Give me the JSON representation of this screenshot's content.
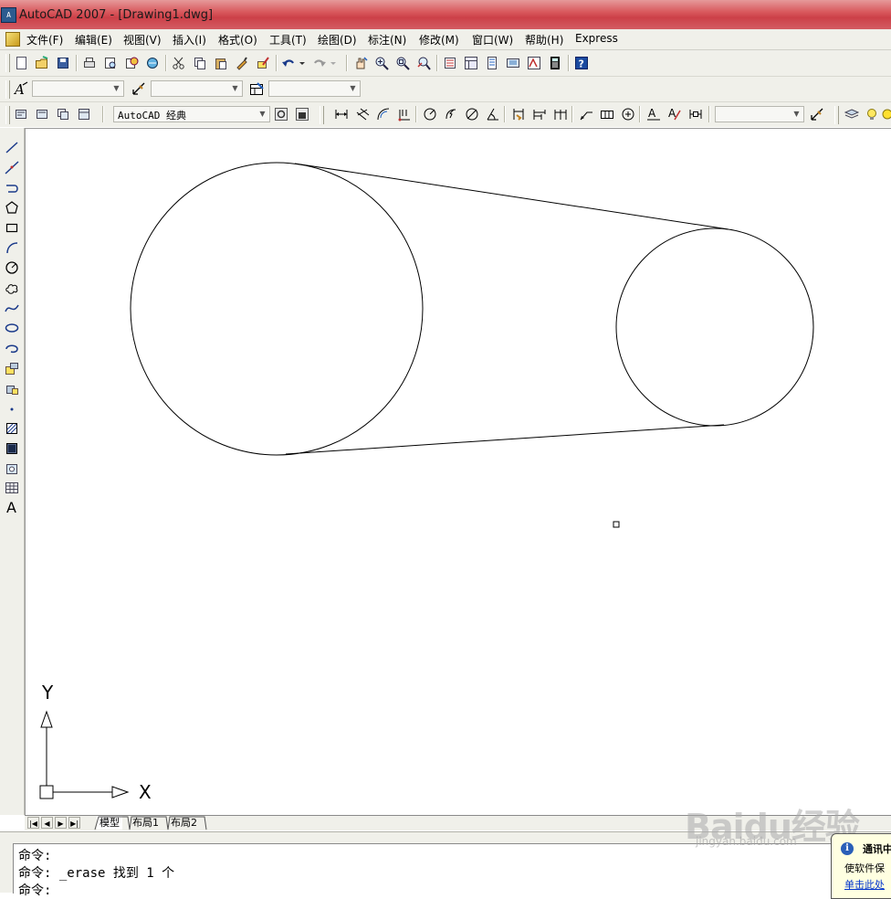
{
  "window": {
    "title": "AutoCAD 2007 - [Drawing1.dwg]",
    "app_icon_text": "A"
  },
  "menu": [
    "文件(F)",
    "编辑(E)",
    "视图(V)",
    "插入(I)",
    "格式(O)",
    "工具(T)",
    "绘图(D)",
    "标注(N)",
    "修改(M)",
    "窗口(W)",
    "帮助(H)",
    "Express"
  ],
  "toolbar_standard": {
    "icons": [
      "new-icon",
      "open-icon",
      "save-icon",
      "plot-icon",
      "plot-preview-icon",
      "publish-icon",
      "3d-dwf-icon",
      "cut-icon",
      "copy-icon",
      "paste-icon",
      "match-properties-icon",
      "block-editor-icon",
      "undo-icon",
      "redo-icon",
      "pan-icon",
      "zoom-realtime-icon",
      "zoom-window-icon",
      "zoom-previous-icon",
      "properties-icon",
      "design-center-icon",
      "tool-palettes-icon",
      "sheet-set-icon",
      "markup-icon",
      "calculator-icon",
      "help-icon"
    ]
  },
  "toolbar_styles": {
    "text_style_value": "",
    "dim_style_value": "",
    "table_style_value": ""
  },
  "toolbar_workspace": {
    "workspace_value": "AutoCAD 经典",
    "layer_value": ""
  },
  "draw_toolbar": {
    "icons": [
      "line-icon",
      "construction-line-icon",
      "polyline-icon",
      "polygon-icon",
      "rectangle-icon",
      "arc-icon",
      "circle-icon",
      "revision-cloud-icon",
      "spline-icon",
      "ellipse-icon",
      "ellipse-arc-icon",
      "insert-block-icon",
      "make-block-icon",
      "point-icon",
      "hatch-icon",
      "gradient-icon",
      "region-icon",
      "table-icon",
      "multiline-text-icon"
    ],
    "text_button_label": "A"
  },
  "ucs": {
    "x_label": "X",
    "y_label": "Y"
  },
  "layout_tabs": [
    "模型",
    "布局1",
    "布局2"
  ],
  "active_tab": 0,
  "command": {
    "line1": "命令:",
    "line2": "命令: _erase 找到 1 个",
    "line3": "命令:"
  },
  "balloon": {
    "title": "通讯中",
    "body": "使软件保",
    "link": "单击此处"
  },
  "watermark": {
    "text": "Baidu经验",
    "sub": "jingyan.baidu.com"
  },
  "colors": {
    "titlebar": "#d95a5e",
    "chrome": "#f0f0ea",
    "drawing_bg": "#ffffff",
    "drawing_stroke": "#000000"
  }
}
